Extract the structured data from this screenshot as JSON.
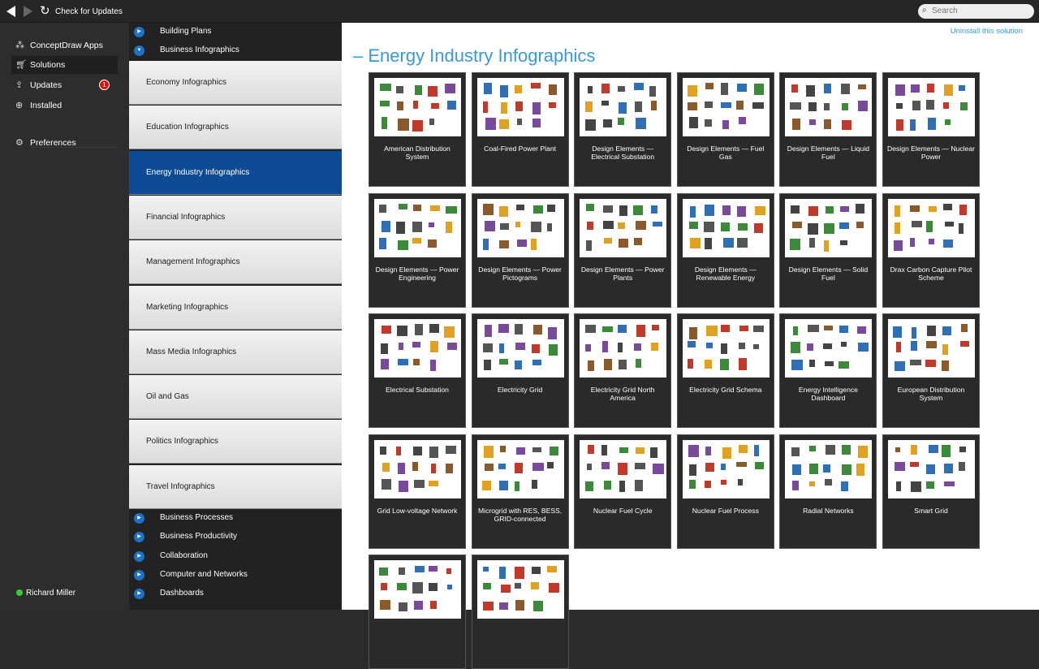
{
  "toolbar": {
    "check_updates": "Check for Updates",
    "search_placeholder": "Search"
  },
  "leftnav": {
    "items": [
      {
        "label": "ConceptDraw Apps",
        "icon": "apps-icon"
      },
      {
        "label": "Solutions",
        "icon": "cart-icon"
      },
      {
        "label": "Updates",
        "icon": "updates-icon",
        "badge": "1"
      },
      {
        "label": "Installed",
        "icon": "download-icon"
      },
      {
        "label": "Preferences",
        "icon": "gear-icon"
      }
    ],
    "user": "Richard Miller"
  },
  "categories_top": [
    "Building Plans",
    "Business Infographics"
  ],
  "subcategories": [
    "Economy Infographics",
    "Education Infographics",
    "Energy Industry Infographics",
    "Financial Infographics",
    "Management Infographics",
    "Marketing Infographics",
    "Mass Media Infographics",
    "Oil and Gas",
    "Politics Infographics",
    "Travel Infographics"
  ],
  "selected_subcategory": "Energy Industry Infographics",
  "categories_bottom": [
    "Business Processes",
    "Business Productivity",
    "Collaboration",
    "Computer and Networks",
    "Dashboards"
  ],
  "main": {
    "uninstall": "Uninstall this solution",
    "title": "Energy Industry Infographics",
    "cards": [
      "American Distribution System",
      "Coal-Fired Power Plant",
      "Design Elements — Electrical Substation",
      "Design Elements — Fuel Gas",
      "Design Elements — Liquid Fuel",
      "Design Elements — Nuclear Power",
      "Design Elements — Power Engineering",
      "Design Elements — Power Pictograms",
      "Design Elements — Power Plants",
      "Design Elements — Renewable Energy",
      "Design Elements — Solid Fuel",
      "Drax Carbon Capture Pilot Scheme",
      "Electrical Substation",
      "Electricity Grid",
      "Electricity Grid North America",
      "Electricity Grid Schema",
      "Energy Intelligence Dashboard",
      "European Distribution System",
      "Grid Low-voltage Network",
      "Microgrid with RES, BESS, GRID-connected",
      "Nuclear Fuel Cycle",
      "Nuclear Fuel Process",
      "Radial Networks",
      "Smart Grid",
      "",
      ""
    ]
  },
  "colors": {
    "accent": "#3a9ad9",
    "selected": "#0f4a94",
    "badge": "#e01010"
  }
}
